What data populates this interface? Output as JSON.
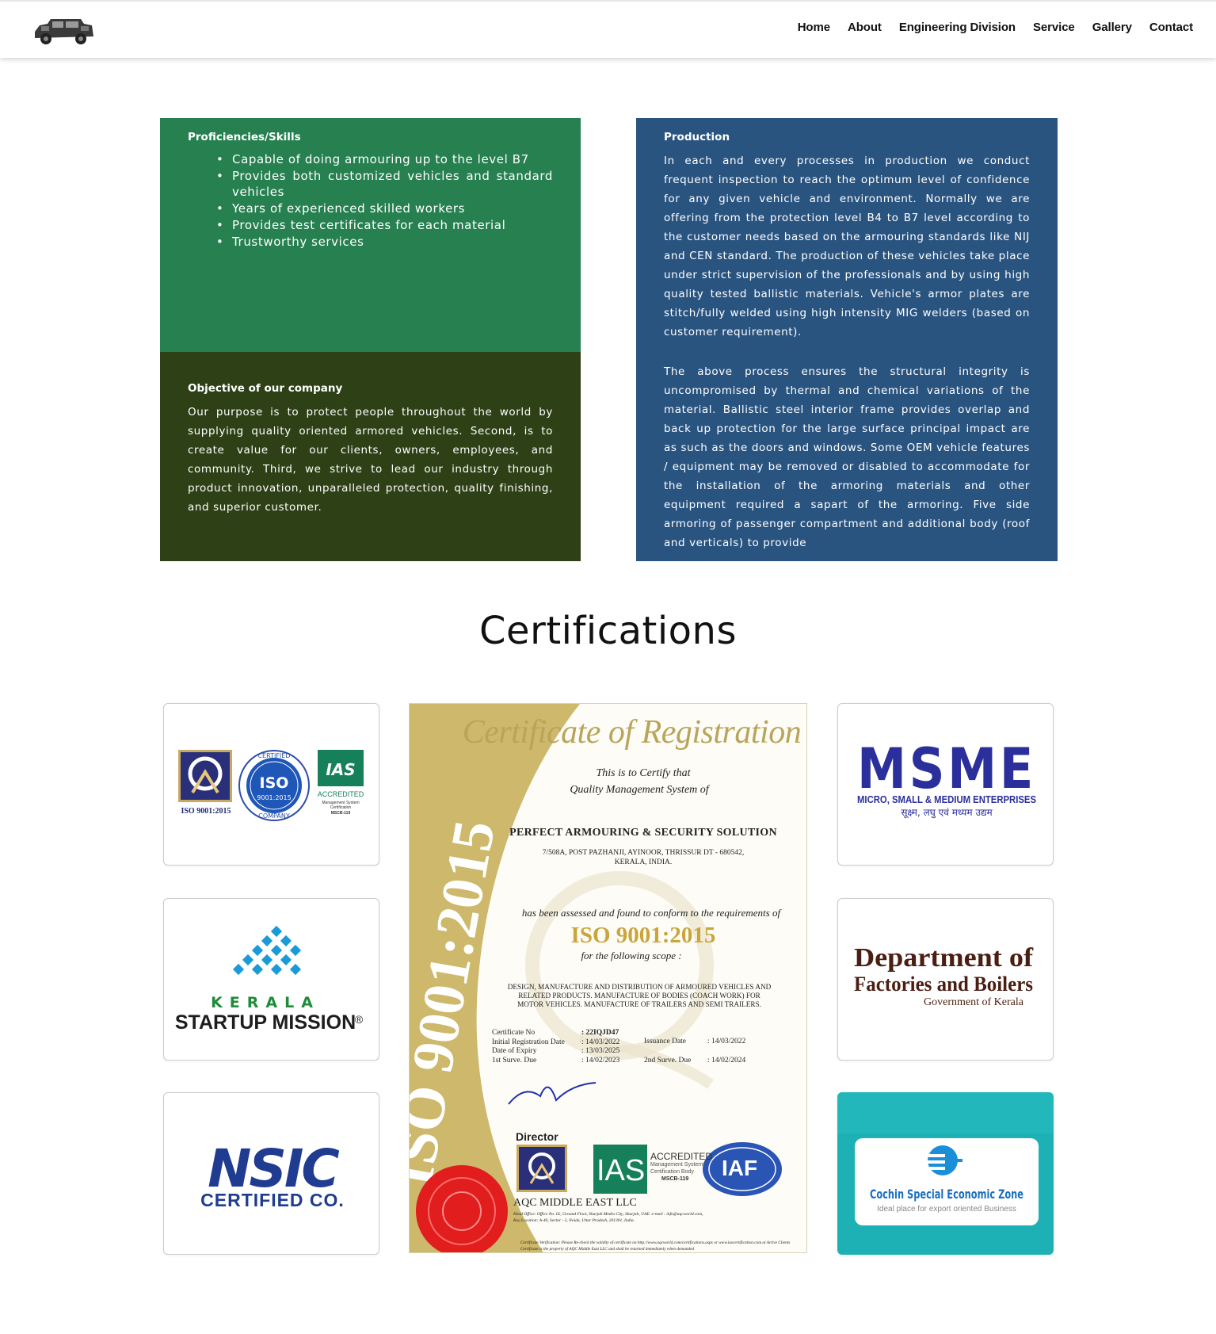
{
  "nav": {
    "items": [
      "Home",
      "About",
      "Engineering Division",
      "Service",
      "Gallery",
      "Contact"
    ]
  },
  "proficiencies": {
    "title": "Proficiencies/Skills",
    "items": [
      "Capable of doing armouring up to the level B7",
      "Provides both customized vehicles and standard vehicles",
      "Years of experienced skilled workers",
      "Provides test certificates for each material",
      "Trustworthy services"
    ]
  },
  "objective": {
    "title": "Objective of our company",
    "text": "Our purpose is to protect people throughout the world by supplying quality oriented armored vehicles. Second, is to create value for our clients, owners, employees, and community. Third, we strive to lead our industry through product innovation, unparalleled protection, quality finishing, and superior customer."
  },
  "production": {
    "title": "Production",
    "para1": "In each and every processes in production we conduct frequent inspection to reach the optimum level of confidence for any given vehicle and environment. Normally we are offering from the protection level B4 to B7 level according to the customer needs based on the armouring standards like NIJ and CEN standard. The production of these vehicles take place under strict supervision of the professionals and by using high quality tested ballistic materials. Vehicle's armor plates are stitch/fully welded using high intensity MIG welders (based on customer requirement).",
    "para2": "The above process ensures the structural integrity is uncompromised by thermal and chemical variations of the material. Ballistic steel interior frame provides overlap and back up protection for the large surface principal impact are as such as the doors and windows. Some OEM vehicle features / equipment may be removed or disabled to accommodate for the installation of the armoring materials and other equipment required a sapart of the armoring. Five side armoring of passenger compartment and additional body (roof and verticals) to provide"
  },
  "certifications": {
    "title": "Certifications",
    "iso_card": {
      "iso_label": "ISO 9001:2015",
      "ring_top": "CERTIFIED",
      "ring_mid": "ISO",
      "ring_std": "9001:2015",
      "ring_bottom": "COMPANY",
      "ias": "IAS",
      "accredited": "ACCREDITED",
      "ias_sub1": "Management System",
      "ias_sub2": "Certification",
      "ias_code": "MSCB-119"
    },
    "msme": {
      "logo": "MSME",
      "line1": "MICRO, SMALL & MEDIUM ENTERPRISES",
      "line2": "सूक्ष्म, लघु एवं मध्यम उद्यम"
    },
    "kerala": {
      "line1": "KERALA",
      "line2": "STARTUP MISSION",
      "reg": "®"
    },
    "factories": {
      "line1": "Department of",
      "line2": "Factories and Boilers",
      "line3": "Government of Kerala"
    },
    "nsic": {
      "logo": "NSIC",
      "line2": "CERTIFIED CO."
    },
    "cochin": {
      "line1": "Cochin Special Economic Zone",
      "line2": "Ideal place for export oriented Business"
    },
    "certificate": {
      "heading": "Certificate of Registration",
      "band": "ISO 9001:2015",
      "certify1": "This is to Certify that",
      "certify2": "Quality Management System of",
      "company": "PERFECT ARMOURING & SECURITY SOLUTION",
      "address1": "7/508A, POST PAZHANJI, AYINOOR, THRISSUR DT - 680542,",
      "address2": "KERALA, INDIA.",
      "assessed": "has been assessed and found to conform to the requirements of",
      "standard": "ISO 9001:2015",
      "scope_label": "for the following scope :",
      "scope1": "DESIGN, MANUFACTURE AND DISTRIBUTION OF ARMOURED VEHICLES AND",
      "scope2": "RELATED PRODUCTS. MANUFACTURE OF BODIES (COACH WORK) FOR",
      "scope3": "MOTOR VEHICLES. MANUFACTURE OF TRAILERS AND SEMI TRAILERS.",
      "cert_no_label": "Certificate No",
      "cert_no": ": 22IQJD47",
      "initial_label": "Initial Registration Date",
      "initial": ": 14/03/2022",
      "issuance_label": "Issuance Date",
      "issuance": ": 14/03/2022",
      "expiry_label": "Date of Expiry",
      "expiry": ": 13/03/2025",
      "surv1_label": "1st Surve. Due",
      "surv1": ": 14/02/2023",
      "surv2_label": "2nd Surve. Due",
      "surv2": ": 14/02/2024",
      "director": "Director",
      "ias": "IAS",
      "accredited": "ACCREDITED",
      "ias_sub1": "Management Systems",
      "ias_sub2": "Certification Body",
      "ias_code": "MSCB-119",
      "iaf": "IAF",
      "issuer": "AQC MIDDLE EAST LLC",
      "fine1": "Head Office: Office No. 02, Ground Floor, Sharjah Media City, Sharjah, UAE. e-mail : info@aqcworld.com,",
      "fine2": "Key Location: A-40, Sector - 2, Noida, Uttar Pradesh, 201301, India.",
      "fine3": "Certificate Verification: Please Re-check the validity of certificate on http://www.aqcworld.com/certifications.aspx or www.iascertification.com at Active Clients",
      "fine4": "Certificate is the property of AQC Middle East LLC and shall be returned immediately when demanded"
    }
  },
  "colors": {
    "green": "#268050",
    "dark_green": "#2e4116",
    "blue": "#2a5480",
    "msme_blue": "#2b2f9c",
    "nsic_blue": "#1f3c91",
    "gold": "#cdb86b",
    "factories_brown": "#4a1e12"
  }
}
